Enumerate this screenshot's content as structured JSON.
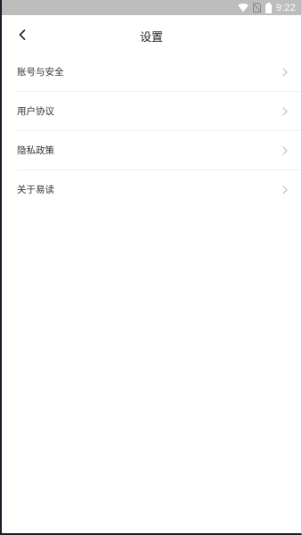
{
  "status_bar": {
    "time": "9:22",
    "icons": [
      "wifi-icon",
      "no-sim-icon",
      "battery-icon"
    ]
  },
  "header": {
    "title": "设置",
    "back_icon": "chevron-left-icon"
  },
  "settings": {
    "items": [
      {
        "label": "账号与安全",
        "icon": "chevron-right-icon"
      },
      {
        "label": "用户协议",
        "icon": "chevron-right-icon"
      },
      {
        "label": "隐私政策",
        "icon": "chevron-right-icon"
      },
      {
        "label": "关于易读",
        "icon": "chevron-right-icon"
      }
    ]
  },
  "colors": {
    "status_bar_bg": "#bdbdbd",
    "background": "#ffffff",
    "divider": "#efefef",
    "chevron": "#bbbbbb",
    "text": "#333333"
  }
}
